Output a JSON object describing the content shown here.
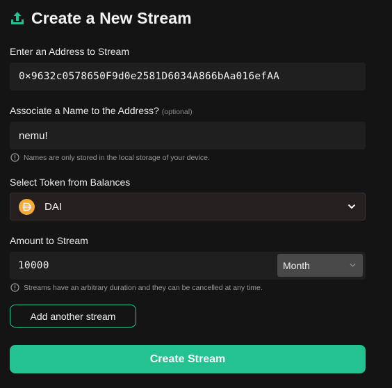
{
  "header": {
    "title": "Create a New Stream",
    "icon": "upload-stream-icon"
  },
  "address": {
    "label": "Enter an Address to Stream",
    "value": "0×9632c0578650F9d0e2581D6034A866bAa016efAA"
  },
  "name": {
    "label": "Associate a Name to the Address?",
    "optional": "(optional)",
    "value": "nemu!",
    "hint": "Names are only stored in the local storage of your device.",
    "hint_icon": "info-icon"
  },
  "token": {
    "label": "Select Token from Balances",
    "selected": "DAI",
    "icon": "dai-token-icon",
    "chevron_icon": "chevron-down-icon"
  },
  "amount": {
    "label": "Amount to Stream",
    "value": "10000",
    "period": "Month",
    "hint": "Streams have an arbitrary duration and they can be cancelled at any time.",
    "hint_icon": "info-icon"
  },
  "actions": {
    "add_label": "Add another stream",
    "create_label": "Create Stream"
  },
  "colors": {
    "accent": "#24c191",
    "background": "#141414",
    "field": "#1f1f1f",
    "dai_yellow": "#f5ac37"
  }
}
